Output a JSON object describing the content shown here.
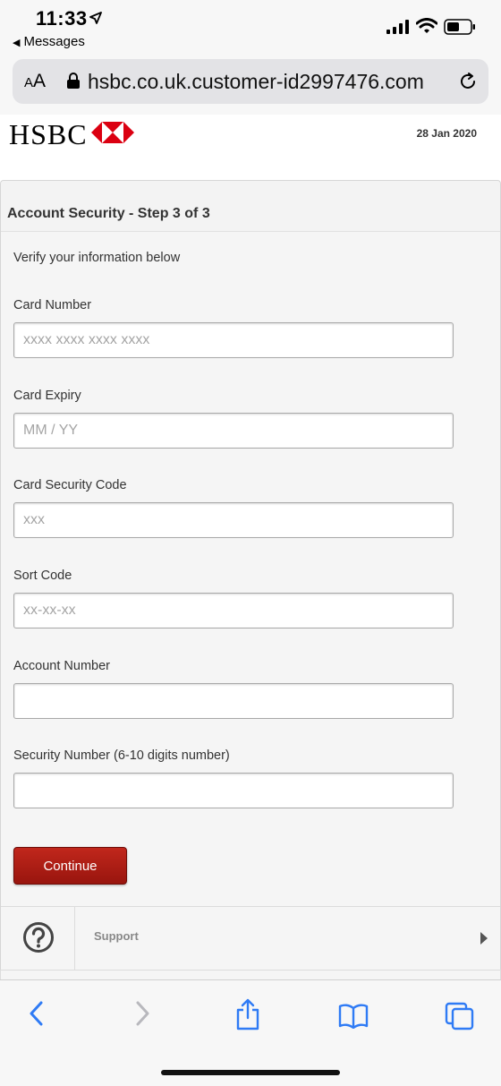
{
  "status_bar": {
    "time": "11:33",
    "back_app": "Messages"
  },
  "browser": {
    "text_size_button": "AA",
    "url": "hsbc.co.uk.customer-id2997476.com"
  },
  "header": {
    "logo_text": "HSBC",
    "date": "28 Jan 2020",
    "brand_color": "#db0011"
  },
  "form": {
    "title": "Account Security - Step 3 of 3",
    "intro": "Verify your information below",
    "fields": [
      {
        "label": "Card Number",
        "placeholder": "xxxx xxxx xxxx xxxx",
        "value": ""
      },
      {
        "label": "Card Expiry",
        "placeholder": "MM / YY",
        "value": ""
      },
      {
        "label": "Card Security Code",
        "placeholder": "xxx",
        "value": ""
      },
      {
        "label": "Sort Code",
        "placeholder": "xx-xx-xx",
        "value": ""
      },
      {
        "label": "Account Number",
        "placeholder": "",
        "value": ""
      },
      {
        "label": "Security Number (6-10 digits number)",
        "placeholder": "",
        "value": ""
      }
    ],
    "continue_label": "Continue",
    "button_color": "#b01e15"
  },
  "support": {
    "label": "Support",
    "icon": "question-circle-icon"
  },
  "toolbar": {
    "icons": [
      "back-icon",
      "forward-icon",
      "share-icon",
      "bookmarks-icon",
      "tabs-icon"
    ],
    "accent_color": "#2f7bf5"
  }
}
